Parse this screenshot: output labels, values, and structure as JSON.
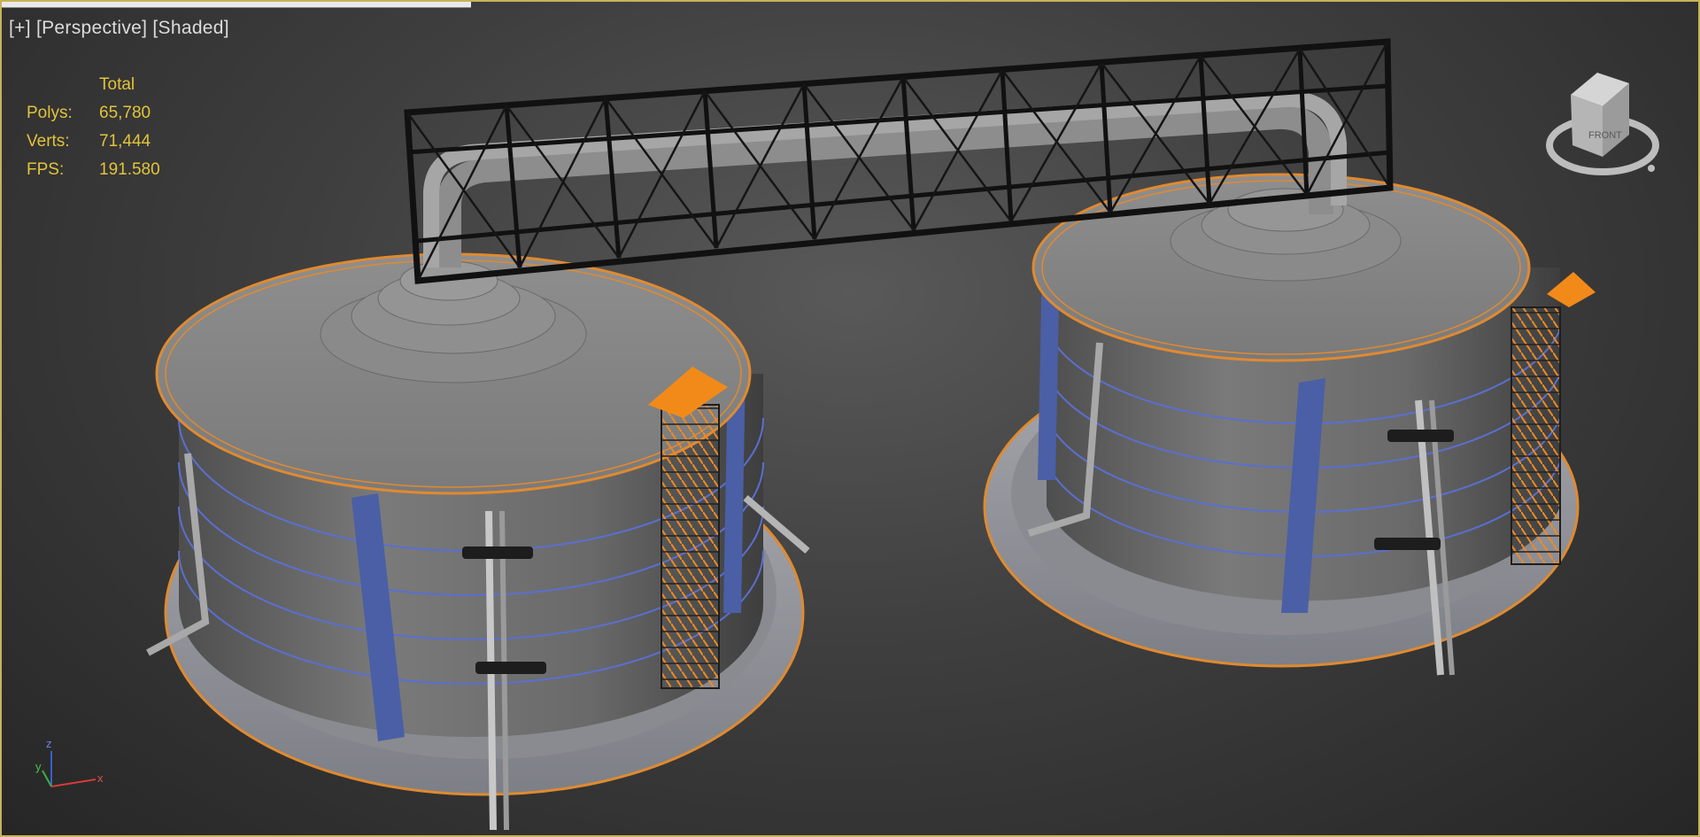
{
  "viewport": {
    "plus_label": "[+]",
    "view_label": "[Perspective]",
    "shading_label": "[Shaded]"
  },
  "stats": {
    "header": "Total",
    "polys_label": "Polys:",
    "polys_value": "65,780",
    "verts_label": "Verts:",
    "verts_value": "71,444",
    "fps_label": "FPS:",
    "fps_value": "191.580"
  },
  "viewcube": {
    "face_label": "FRONT"
  },
  "axis_gizmo": {
    "z": "z",
    "y": "y",
    "x": "x"
  },
  "colors": {
    "frame": "#c8b25a",
    "stats_text": "#e2c33b",
    "tank": "#8c8c8c",
    "blue_pillar": "#4a5fa6",
    "orange": "#f28a1a",
    "truss": "#1a1a1a"
  }
}
